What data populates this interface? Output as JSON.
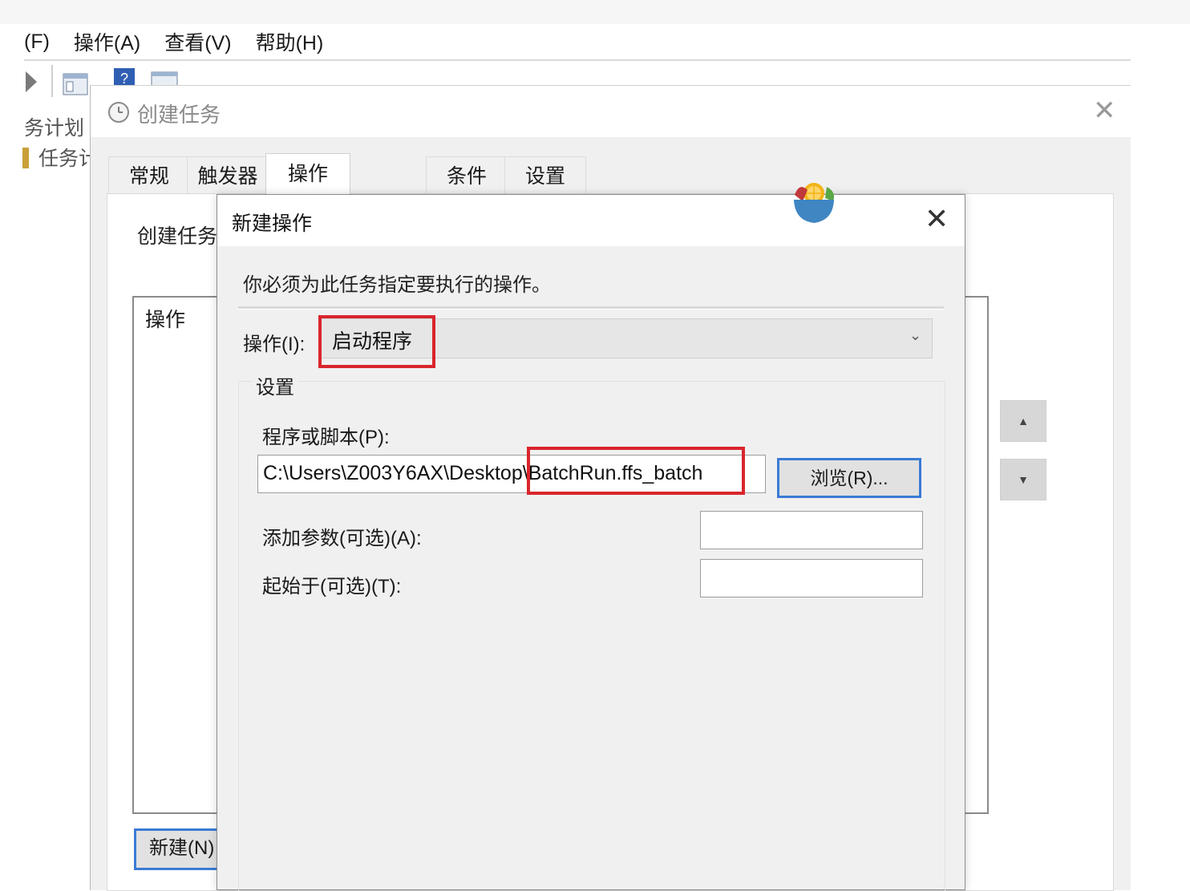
{
  "menubar": {
    "items": [
      "(F)",
      "操作(A)",
      "查看(V)",
      "帮助(H)"
    ]
  },
  "tree": {
    "items": [
      "务计划",
      "任务计"
    ]
  },
  "create_dialog": {
    "title": "创建任务",
    "tabs": [
      "常规",
      "触发器",
      "操作",
      "条件",
      "设置"
    ],
    "active_tab": "操作",
    "description": "创建任务",
    "list_header": "操作",
    "new_button": "新建(N)"
  },
  "new_action_dialog": {
    "title": "新建操作",
    "message": "你必须为此任务指定要执行的操作。",
    "action_label": "操作(I):",
    "action_value": "启动程序",
    "settings_label": "设置",
    "program_label": "程序或脚本(P):",
    "program_value": "C:\\Users\\Z003Y6AX\\Desktop\\BatchRun.ffs_batch",
    "browse_button": "浏览(R)...",
    "args_label": "添加参数(可选)(A):",
    "args_value": "",
    "start_in_label": "起始于(可选)(T):",
    "start_in_value": ""
  },
  "icons": {
    "close": "close-icon",
    "chevron": "chevron-down-icon",
    "clock": "clock-icon",
    "up": "arrow-up-icon",
    "down": "arrow-down-icon"
  },
  "colors": {
    "highlight": "#d9252c",
    "focus_border": "#3a7bd5",
    "dialog_bg": "#f0f0f0"
  }
}
